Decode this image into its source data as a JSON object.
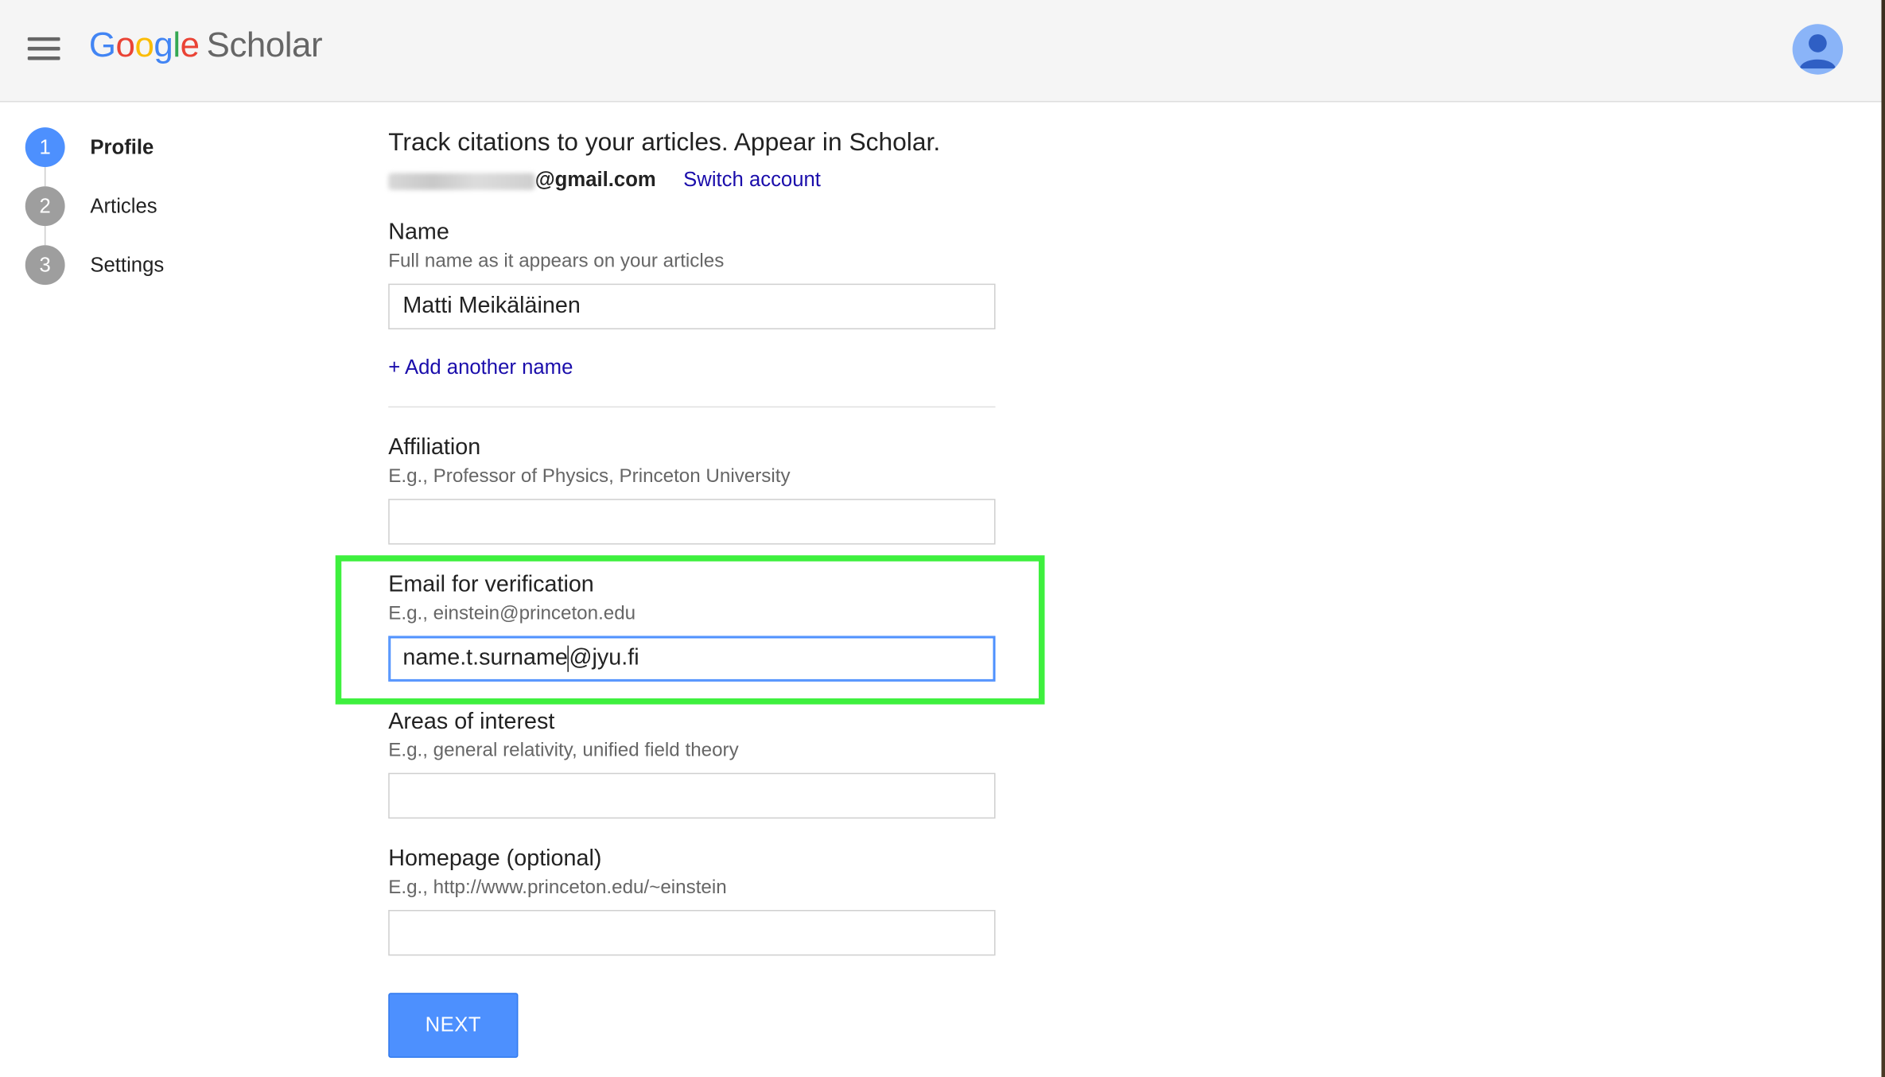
{
  "header": {
    "logo_letters": [
      "G",
      "o",
      "o",
      "g",
      "l",
      "e"
    ],
    "logo_product": "Scholar"
  },
  "steps": [
    {
      "number": "1",
      "label": "Profile",
      "active": true
    },
    {
      "number": "2",
      "label": "Articles",
      "active": false
    },
    {
      "number": "3",
      "label": "Settings",
      "active": false
    }
  ],
  "intro": {
    "headline": "Track citations to your articles. Appear in Scholar.",
    "email_domain": "@gmail.com",
    "switch_account": "Switch account"
  },
  "form": {
    "name": {
      "label": "Name",
      "hint": "Full name as it appears on your articles",
      "value": "Matti Meikäläinen"
    },
    "add_name": "+ Add another name",
    "affiliation": {
      "label": "Affiliation",
      "hint": "E.g., Professor of Physics, Princeton University",
      "value": ""
    },
    "email": {
      "label": "Email for verification",
      "hint": "E.g., einstein@princeton.edu",
      "value_before_caret": "name.t.surname",
      "value_after_caret": "@jyu.fi"
    },
    "interests": {
      "label": "Areas of interest",
      "hint": "E.g., general relativity, unified field theory",
      "value": ""
    },
    "homepage": {
      "label": "Homepage (optional)",
      "hint": "E.g., http://www.princeton.edu/~einstein",
      "value": ""
    },
    "next_label": "NEXT"
  },
  "colors": {
    "accent": "#4d90fe",
    "link": "#1a0dab",
    "highlight": "#3ef03e",
    "step_inactive": "#9e9e9e"
  }
}
